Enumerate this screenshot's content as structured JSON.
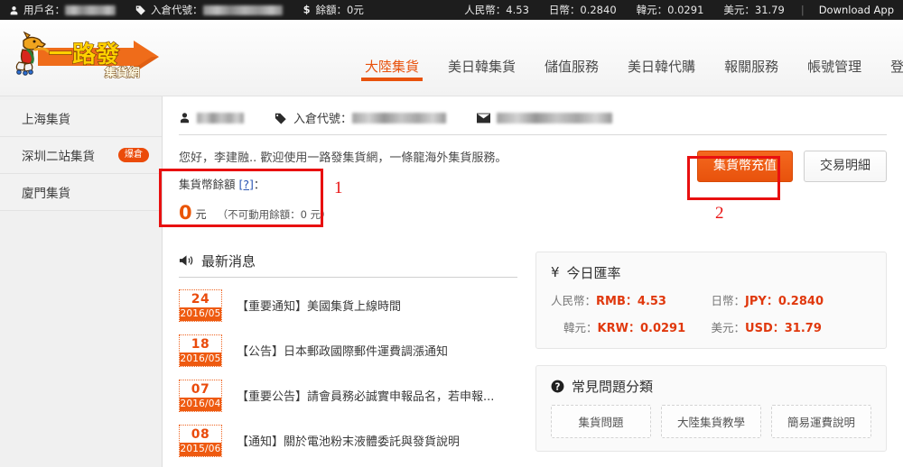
{
  "topbar": {
    "username_label": "用戶名：",
    "username_value_redacted": true,
    "warehouse_label": "入倉代號：",
    "warehouse_value_redacted": true,
    "balance_label": "餘額：",
    "balance_value": "0元",
    "rates": [
      {
        "name": "人民幣",
        "sep": "：",
        "value": "4.53"
      },
      {
        "name": "日幣",
        "sep": "：",
        "value": "0.2840"
      },
      {
        "name": "韓元",
        "sep": "：",
        "value": "0.0291"
      },
      {
        "name": "美元",
        "sep": "：",
        "value": "31.79"
      }
    ],
    "separator": "|",
    "download_app": "Download App"
  },
  "logo": {
    "main_text": "一路發",
    "sub_text": "集貨網",
    "colors": {
      "arrow": "#ef6c1a",
      "text": "#ffd000"
    }
  },
  "nav": {
    "items": [
      {
        "label": "大陸集貨",
        "active": true
      },
      {
        "label": "美日韓集貨",
        "active": false
      },
      {
        "label": "儲值服務",
        "active": false
      },
      {
        "label": "美日韓代購",
        "active": false
      },
      {
        "label": "報關服務",
        "active": false
      },
      {
        "label": "帳號管理",
        "active": false
      },
      {
        "label": "登出",
        "active": false
      }
    ],
    "accent_color": "#e8520c"
  },
  "sidebar": {
    "items": [
      {
        "label": "上海集貨",
        "badge": ""
      },
      {
        "label": "深圳二站集貨",
        "badge": "爆倉"
      },
      {
        "label": "廈門集貨",
        "badge": ""
      }
    ],
    "badge_color": "#eb4b0a"
  },
  "userstrip": {
    "name_redacted": true,
    "warehouse_label": "入倉代號：",
    "warehouse_redacted": true,
    "email_redacted": true
  },
  "greeting": "您好，李建融.. 歡迎使用一路發集貨網，一條龍海外集貨服務。",
  "balance_box": {
    "title": "集貨幣餘額",
    "help_link": "[?]",
    "colon": "：",
    "amount": "0",
    "unit": "元",
    "note": "（不可動用餘額：0 元）",
    "amount_color": "#ea5504"
  },
  "actions": {
    "topup_label": "集貨幣充值",
    "history_label": "交易明細"
  },
  "news": {
    "title": "最新消息",
    "items": [
      {
        "day": "24",
        "ym": "2016/05",
        "title": "【重要通知】美國集貨上線時間"
      },
      {
        "day": "18",
        "ym": "2016/05",
        "title": "【公告】日本郵政國際郵件運費調漲通知"
      },
      {
        "day": "07",
        "ym": "2016/04",
        "title": "【重要公告】請會員務必誠實申報品名，若申報..."
      },
      {
        "day": "08",
        "ym": "2015/06",
        "title": "【通知】關於電池粉末液體委託與發貨說明"
      }
    ]
  },
  "rates_panel": {
    "title": "今日匯率",
    "icon": "¥",
    "rows": [
      {
        "name": "人民幣",
        "code": "RMB",
        "value": "4.53"
      },
      {
        "name": "日幣",
        "code": "JPY",
        "value": "0.2840"
      },
      {
        "name": "韓元",
        "code": "KRW",
        "value": "0.0291"
      },
      {
        "name": "美元",
        "code": "USD",
        "value": "31.79"
      }
    ],
    "value_color": "#e0380d"
  },
  "faq": {
    "title": "常見問題分類",
    "buttons": [
      "集貨問題",
      "大陸集貨教學",
      "簡易運費說明"
    ]
  },
  "annotations": [
    {
      "number": "1"
    },
    {
      "number": "2"
    }
  ]
}
